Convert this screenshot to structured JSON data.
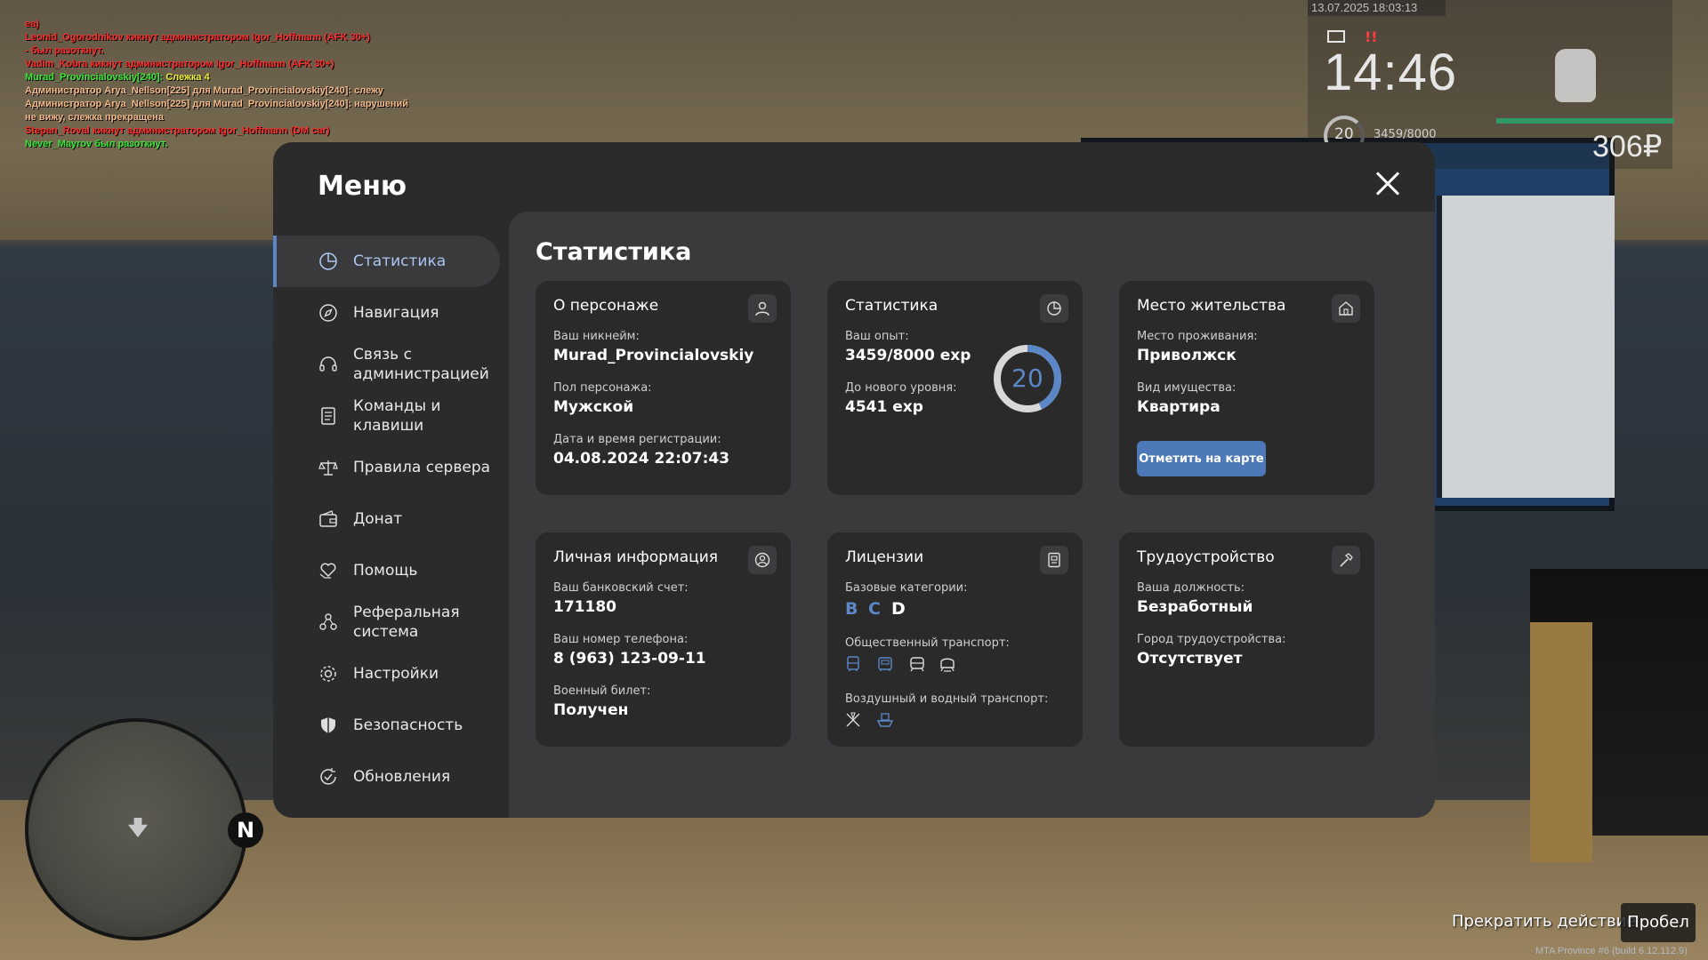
{
  "chat": [
    {
      "color": "red",
      "text": "ea)"
    },
    {
      "color": "red",
      "text": "Leonid_Ogorodnikov кикнут администратором Igor_Hoffmann (AFK 30+)"
    },
    {
      "color": "red",
      "text": "- был разоткнут."
    },
    {
      "color": "red",
      "text": "Vadim_Kobra кикнут администратором Igor_Hoffmann (AFK 30+)"
    },
    {
      "color": "green_yellow",
      "name": "Murad_Provincialovskiy[240]:",
      "text": " Слежка 4"
    },
    {
      "color": "orange",
      "text": "Администратор Arya_Nellson[225] для Murad_Provincialovskiy[240]: слежу"
    },
    {
      "color": "orange",
      "text": "Администратор Arya_Nellson[225] для Murad_Provincialovskiy[240]: нарушений"
    },
    {
      "color": "orange",
      "text": "не вижу, слежка прекращена"
    },
    {
      "color": "red",
      "text": "Stepan_Roval кикнут администратором Igor_Hoffmann (DM car)"
    },
    {
      "color": "green",
      "text": "Never_Mayrov был разоткнут."
    }
  ],
  "hud": {
    "datetime": "13.07.2025 18:03:13",
    "clock": "14:46",
    "level": "20",
    "exp": "3459/8000",
    "money": "306₽"
  },
  "prompts": {
    "stop_action": "Прекратить действие",
    "key": "Пробел",
    "build": "MTA Province #6 (build 6.12.112.9)"
  },
  "minimap": {
    "north": "N"
  },
  "menu": {
    "title": "Меню",
    "sidebar": [
      {
        "label": "Статистика",
        "icon": "pie-chart-icon",
        "active": true
      },
      {
        "label": "Навигация",
        "icon": "compass-icon"
      },
      {
        "label": "Связь с администрацией",
        "icon": "headset-icon"
      },
      {
        "label": "Команды и клавиши",
        "icon": "document-list-icon"
      },
      {
        "label": "Правила сервера",
        "icon": "scales-icon"
      },
      {
        "label": "Донат",
        "icon": "wallet-icon"
      },
      {
        "label": "Помощь",
        "icon": "heart-hand-icon"
      },
      {
        "label": "Реферальная система",
        "icon": "people-network-icon"
      },
      {
        "label": "Настройки",
        "icon": "gear-icon"
      },
      {
        "label": "Безопасность",
        "icon": "shield-icon"
      },
      {
        "label": "Обновления",
        "icon": "update-check-icon"
      }
    ],
    "section_title": "Статистика",
    "cards": {
      "character": {
        "title": "О персонаже",
        "nick_label": "Ваш никнейм:",
        "nick": "Murad_Provincialovskiy",
        "gender_label": "Пол персонажа:",
        "gender": "Мужской",
        "reg_label": "Дата и время регистрации:",
        "reg": "04.08.2024 22:07:43"
      },
      "stats": {
        "title": "Статистика",
        "exp_label": "Ваш опыт:",
        "exp": "3459/8000 exp",
        "next_label": "До нового уровня:",
        "next": "4541 exp",
        "level": "20",
        "progress": 0.43
      },
      "residence": {
        "title": "Место жительства",
        "place_label": "Место проживания:",
        "place": "Приволжск",
        "property_label": "Вид имущества:",
        "property": "Квартира",
        "map_button": "Отметить на карте"
      },
      "personal": {
        "title": "Личная информация",
        "bank_label": "Ваш банковский счет:",
        "bank": "171180",
        "phone_label": "Ваш номер телефона:",
        "phone": "8 (963) 123-09-11",
        "military_label": "Военный билет:",
        "military": "Получен"
      },
      "licenses": {
        "title": "Лицензии",
        "base_label": "Базовые категории:",
        "cat_b": "B",
        "cat_c": "C",
        "cat_d": "D",
        "public_label": "Общественный транспорт:",
        "air_label": "Воздушный и водный транспорт:"
      },
      "employment": {
        "title": "Трудоустройство",
        "position_label": "Ваша должность:",
        "position": "Безработный",
        "city_label": "Город трудоустройства:",
        "city": "Отсутствует"
      }
    }
  },
  "colors": {
    "accent": "#5b87c6",
    "button": "#4d79b8",
    "panel": "#2b2b2c",
    "content": "#3a3a3c",
    "card": "#2a2a2b"
  }
}
